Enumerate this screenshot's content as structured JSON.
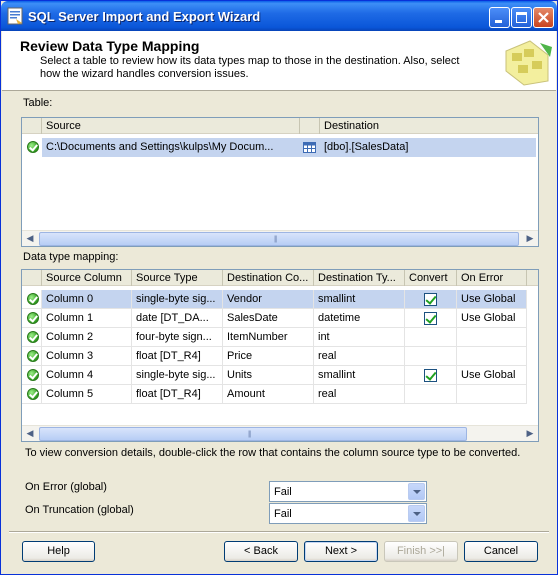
{
  "window": {
    "title": "SQL Server Import and Export Wizard"
  },
  "header": {
    "title": "Review Data Type Mapping",
    "description": "Select a table to review how its data types map to those in the destination. Also, select how the wizard handles conversion issues."
  },
  "table_section": {
    "label": "Table:",
    "columns": [
      "Source",
      "Destination"
    ],
    "rows": [
      {
        "source": "C:\\Documents and Settings\\kulps\\My Docum...",
        "destination": "[dbo].[SalesData]"
      }
    ]
  },
  "mapping_section": {
    "label": "Data type mapping:",
    "columns": [
      "Source Column",
      "Source Type",
      "Destination Co...",
      "Destination Ty...",
      "Convert",
      "On Error"
    ],
    "rows": [
      {
        "source_column": "Column 0",
        "source_type": "single-byte sig...",
        "dest_column": "Vendor",
        "dest_type": "smallint",
        "convert": true,
        "on_error": "Use Global"
      },
      {
        "source_column": "Column 1",
        "source_type": "date [DT_DA...",
        "dest_column": "SalesDate",
        "dest_type": "datetime",
        "convert": true,
        "on_error": "Use Global"
      },
      {
        "source_column": "Column 2",
        "source_type": "four-byte sign...",
        "dest_column": "ItemNumber",
        "dest_type": "int",
        "convert": false,
        "on_error": ""
      },
      {
        "source_column": "Column 3",
        "source_type": "float [DT_R4]",
        "dest_column": "Price",
        "dest_type": "real",
        "convert": false,
        "on_error": ""
      },
      {
        "source_column": "Column 4",
        "source_type": "single-byte sig...",
        "dest_column": "Units",
        "dest_type": "smallint",
        "convert": true,
        "on_error": "Use Global"
      },
      {
        "source_column": "Column 5",
        "source_type": "float [DT_R4]",
        "dest_column": "Amount",
        "dest_type": "real",
        "convert": false,
        "on_error": ""
      }
    ]
  },
  "hint": "To view conversion details, double-click the row that contains the column source type to be converted.",
  "global_options": {
    "on_error_label": "On Error (global)",
    "on_error_value": "Fail",
    "on_truncation_label": "On Truncation (global)",
    "on_truncation_value": "Fail"
  },
  "buttons": {
    "help": "Help",
    "back": "< Back",
    "next": "Next >",
    "finish": "Finish >>|",
    "cancel": "Cancel"
  },
  "colors": {
    "title_bar": "#0a56d8",
    "selection": "#c4d4ef",
    "window_bg": "#ece9d8"
  }
}
